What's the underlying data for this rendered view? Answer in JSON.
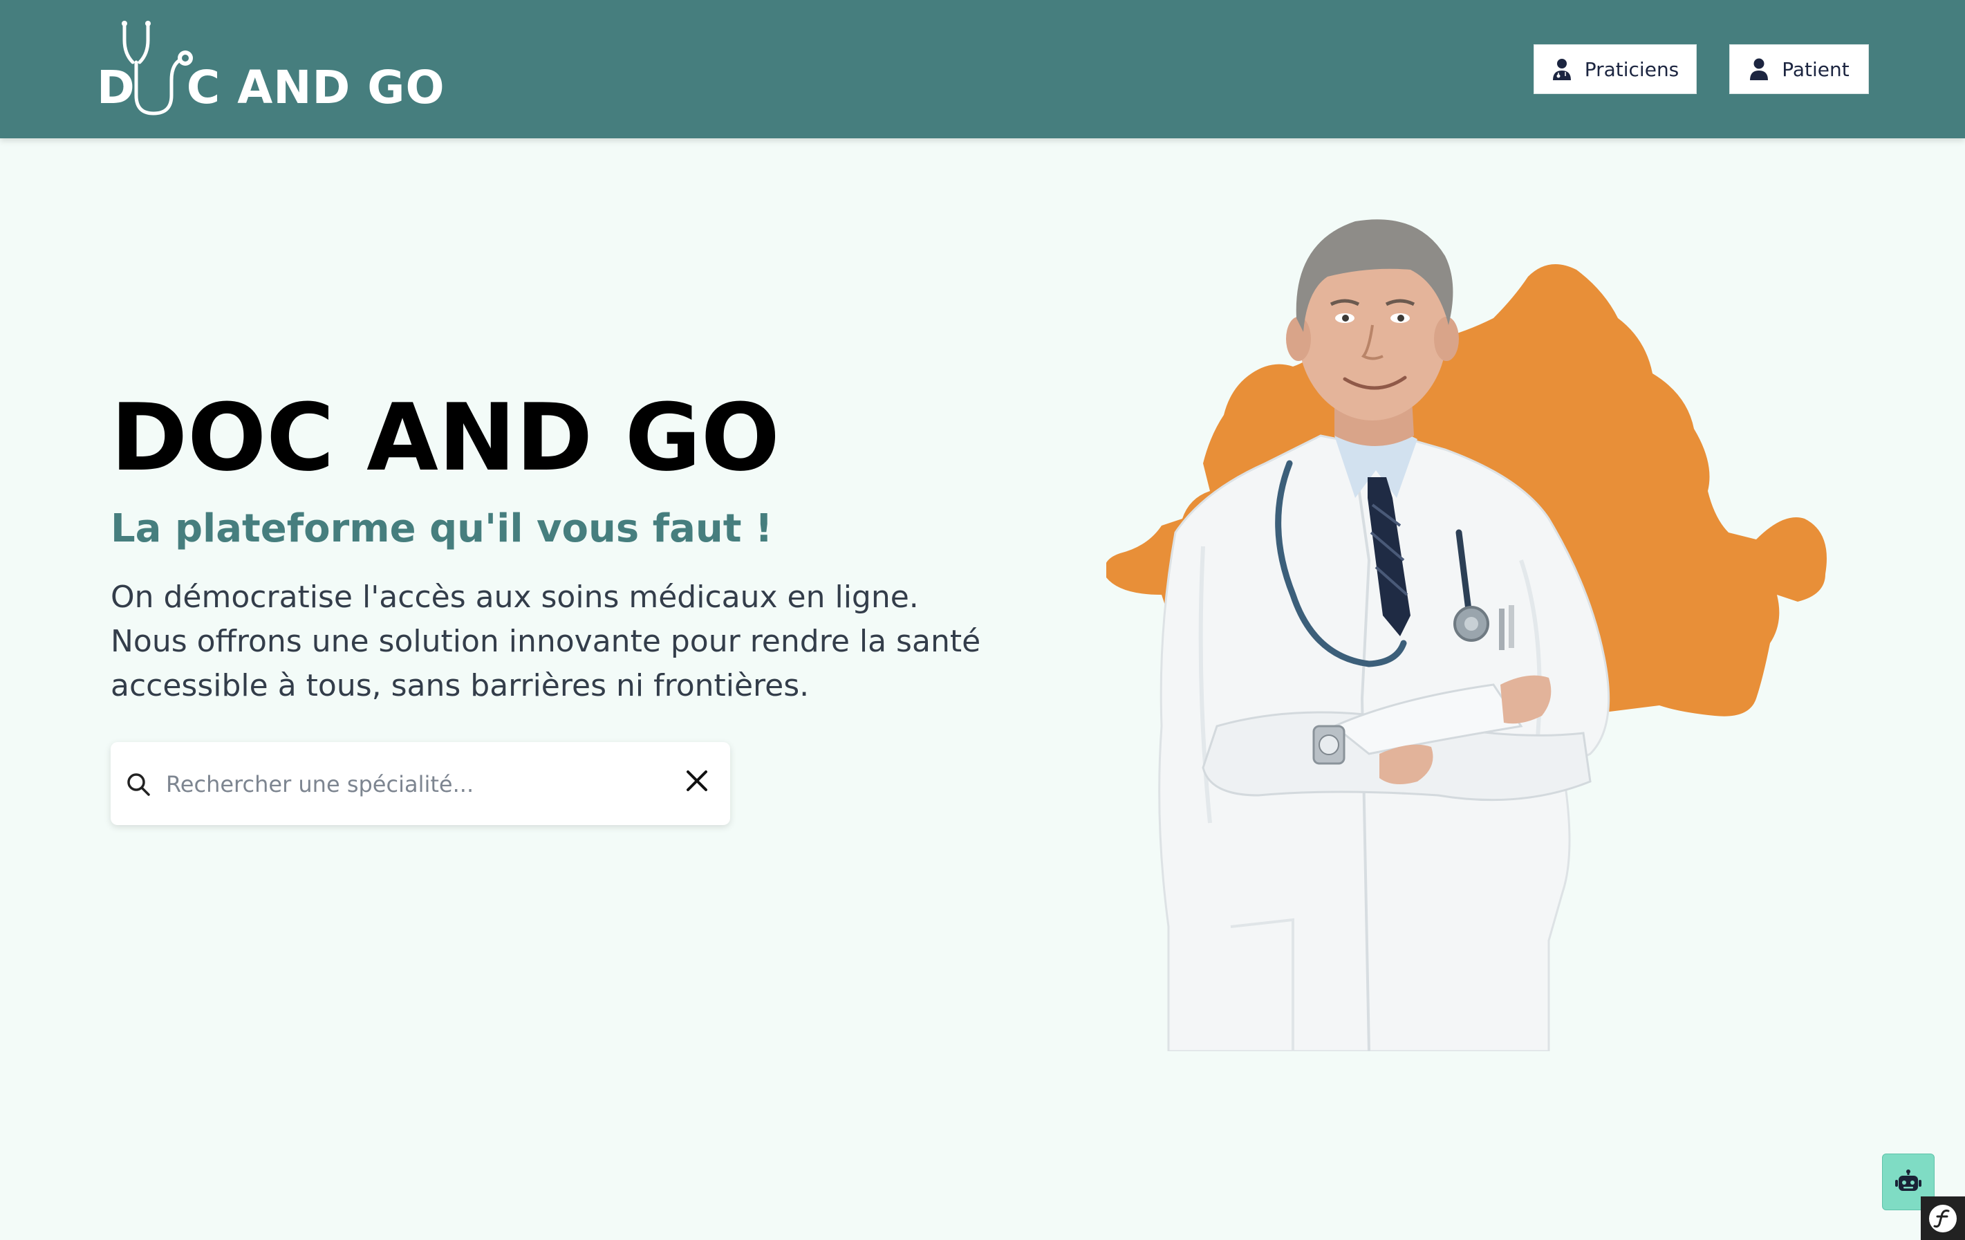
{
  "header": {
    "logo_text_d": "D",
    "logo_text_rest": "C AND GO",
    "praticiens_label": "Praticiens",
    "patient_label": "Patient"
  },
  "hero": {
    "title": "DOC AND GO",
    "subtitle": "La plateforme qu'il vous faut !",
    "description": "On démocratise l'accès aux soins médicaux en ligne. Nous offrons une solution innovante pour rendre la santé accessible à tous, sans barrières ni frontières."
  },
  "search": {
    "placeholder": "Rechercher une spécialité...",
    "value": ""
  },
  "icons": {
    "logo": "stethoscope-icon",
    "praticiens": "doctor-icon",
    "patient": "user-icon",
    "search": "search-icon",
    "clear": "close-icon",
    "bot": "robot-icon",
    "debug": "symfony-icon"
  },
  "colors": {
    "header_bg": "#467e7e",
    "page_bg": "#f3fbf8",
    "subtitle": "#467e7e",
    "map_shape": "#e88f38",
    "bot_button": "#7fdcc4"
  }
}
